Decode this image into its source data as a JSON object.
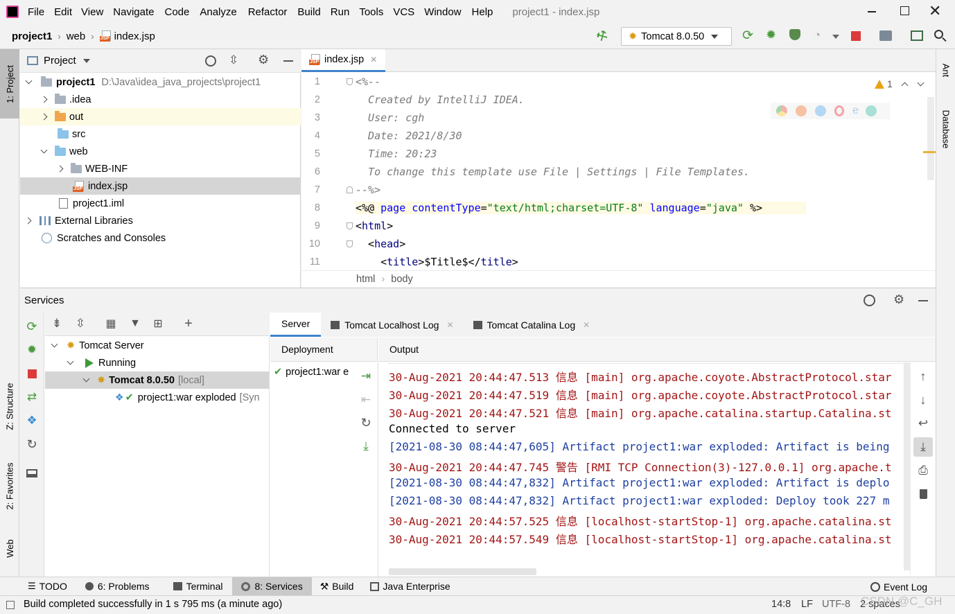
{
  "window": {
    "title": "project1 - index.jsp",
    "menu": [
      "File",
      "Edit",
      "View",
      "Navigate",
      "Code",
      "Analyze",
      "Refactor",
      "Build",
      "Run",
      "Tools",
      "VCS",
      "Window",
      "Help"
    ]
  },
  "navbar": {
    "breadcrumb": [
      "project1",
      "web",
      "index.jsp"
    ],
    "run_config": "Tomcat 8.0.50"
  },
  "left_stripe": {
    "project": "1: Project",
    "structure": "Z: Structure",
    "favorites": "2: Favorites",
    "web": "Web"
  },
  "right_stripe": {
    "ant": "Ant",
    "database": "Database"
  },
  "project_panel": {
    "title": "Project",
    "tree": [
      {
        "name": "project1",
        "path": "D:\\Java\\idea_java_projects\\project1"
      },
      {
        "name": ".idea"
      },
      {
        "name": "out"
      },
      {
        "name": "src"
      },
      {
        "name": "web"
      },
      {
        "name": "WEB-INF"
      },
      {
        "name": "index.jsp"
      },
      {
        "name": "project1.iml"
      },
      {
        "name": "External Libraries"
      },
      {
        "name": "Scratches and Consoles"
      }
    ]
  },
  "editor": {
    "tab": "index.jsp",
    "warnings": "1",
    "line_numbers": [
      "1",
      "2",
      "3",
      "4",
      "5",
      "6",
      "7",
      "8",
      "9",
      "10",
      "11"
    ],
    "lines": {
      "l1": "<%--",
      "l2": "  Created by IntelliJ IDEA.",
      "l3": "  User: cgh",
      "l4": "  Date: 2021/8/30",
      "l5": "  Time: 20:23",
      "l6": "  To change this template use File | Settings | File Templates.",
      "l7": "--%>",
      "l8_a": "<%@ ",
      "l8_b": "page ",
      "l8_c": "contentType",
      "l8_d": "=",
      "l8_e": "\"text/html;charset=UTF-8\"",
      "l8_f": " language",
      "l8_g": "=",
      "l8_h": "\"java\"",
      "l8_i": " %>",
      "l9_a": "<",
      "l9_b": "html",
      "l9_c": ">",
      "l10_a": "  <",
      "l10_b": "head",
      "l10_c": ">",
      "l11_a": "    <",
      "l11_b": "title",
      "l11_c": ">$Title$</",
      "l11_d": "title",
      "l11_e": ">"
    },
    "breadcrumb": [
      "html",
      "body"
    ]
  },
  "services": {
    "title": "Services",
    "tree": [
      {
        "name": "Tomcat Server"
      },
      {
        "name": "Running"
      },
      {
        "name": "Tomcat 8.0.50",
        "suffix": "[local]"
      },
      {
        "name": "project1:war exploded",
        "suffix": "[Syn"
      }
    ],
    "tabs": [
      "Server",
      "Tomcat Localhost Log",
      "Tomcat Catalina Log"
    ],
    "deployment_header": "Deployment",
    "deployment_item": "project1:war e",
    "output_header": "Output",
    "output": [
      {
        "text": "30-Aug-2021 20:44:47.513 信息 [main] org.apache.coyote.AbstractProtocol.star",
        "kind": "red"
      },
      {
        "text": "30-Aug-2021 20:44:47.519 信息 [main] org.apache.coyote.AbstractProtocol.star",
        "kind": "red"
      },
      {
        "text": "30-Aug-2021 20:44:47.521 信息 [main] org.apache.catalina.startup.Catalina.st",
        "kind": "red"
      },
      {
        "text": "Connected to server",
        "kind": "black"
      },
      {
        "text": "[2021-08-30 08:44:47,605] Artifact project1:war exploded: Artifact is being",
        "kind": "blue"
      },
      {
        "text": "30-Aug-2021 20:44:47.745 警告 [RMI TCP Connection(3)-127.0.0.1] org.apache.t",
        "kind": "red"
      },
      {
        "text": "[2021-08-30 08:44:47,832] Artifact project1:war exploded: Artifact is deplo",
        "kind": "blue"
      },
      {
        "text": "[2021-08-30 08:44:47,832] Artifact project1:war exploded: Deploy took 227 m",
        "kind": "blue"
      },
      {
        "text": "30-Aug-2021 20:44:57.525 信息 [localhost-startStop-1] org.apache.catalina.st",
        "kind": "red"
      },
      {
        "text": "30-Aug-2021 20:44:57.549 信息 [localhost-startStop-1] org.apache.catalina.st",
        "kind": "red"
      }
    ]
  },
  "bottom_tabs": [
    "TODO",
    "6: Problems",
    "Terminal",
    "8: Services",
    "Build",
    "Java Enterprise"
  ],
  "event_log": "Event Log",
  "status": {
    "message": "Build completed successfully in 1 s 795 ms (a minute ago)",
    "position": "14:8",
    "line_sep": "LF",
    "encoding": "UTF-8",
    "indent": "2 spaces",
    "watermark": "CSDN @C_GH"
  }
}
